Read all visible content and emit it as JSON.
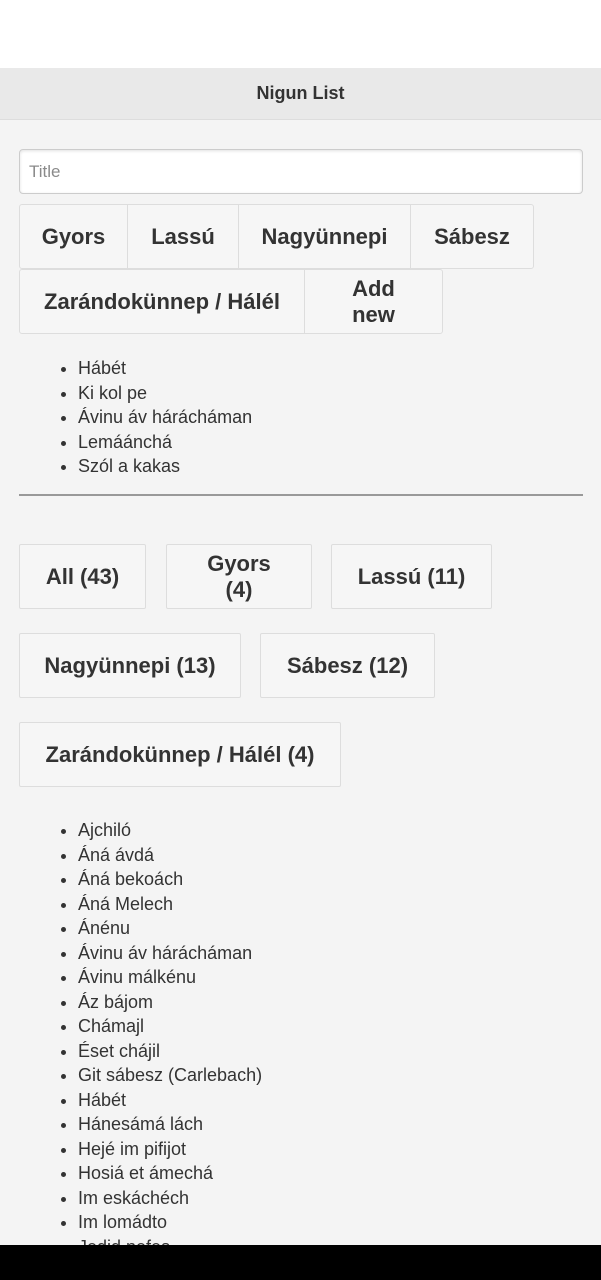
{
  "header": {
    "title": "Nigun List"
  },
  "form": {
    "title_placeholder": "Title",
    "title_value": "",
    "tags": [
      "Gyors",
      "Lassú",
      "Nagyünnepi",
      "Sábesz",
      "Zarándokünnep / Hálél"
    ],
    "add_new_label": "Add new"
  },
  "recent_items": [
    "Hábét",
    "Ki kol pe",
    "Ávinu áv hárácháman",
    "Lemáánchá",
    "Szól a kakas"
  ],
  "filters": [
    {
      "label": "All (43)"
    },
    {
      "label": "Gyors (4)"
    },
    {
      "label": "Lassú (11)"
    },
    {
      "label": "Nagyünnepi (13)"
    },
    {
      "label": "Sábesz (12)"
    },
    {
      "label": "Zarándokünnep / Hálél (4)"
    }
  ],
  "songs": [
    "Ajchiló",
    "Áná ávdá",
    "Áná bekoách",
    "Áná Melech",
    "Ánénu",
    "Ávinu áv hárácháman",
    "Ávinu málkénu",
    "Áz bájom",
    "Chámajl",
    "Éset chájil",
    "Git sábesz (Carlebach)",
    "Hábét",
    "Hánesámá lách",
    "Hejé im pifijot",
    "Hosiá et ámechá",
    "Im eskáchéch",
    "Im lomádto",
    "Jedid nefes"
  ]
}
